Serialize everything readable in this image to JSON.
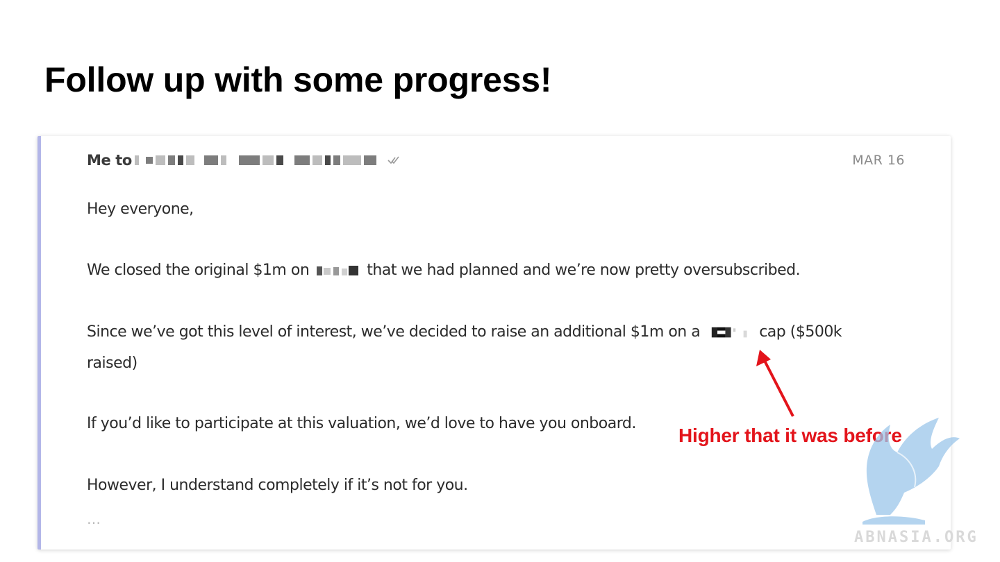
{
  "slide": {
    "title": "Follow up with some progress!"
  },
  "email": {
    "sender": "Me to",
    "date": "MAR 16",
    "greeting": "Hey everyone,",
    "para1_a": "We closed the original $1m on",
    "para1_b": "that we had planned and we’re now pretty oversubscribed.",
    "para2_a": "Since we’ve got this level of interest, we’ve decided to raise an additional $1m on a",
    "para2_b": "cap ($500k",
    "para2_c": "raised)",
    "para3": "If you’d like to participate at this valuation, we’d love to have you onboard.",
    "para4": "However, I understand completely if it’s not for you.",
    "ellipsis": "…",
    "accent_color": "#b3b6e8"
  },
  "annotation": {
    "text": "Higher that it was before",
    "color": "#e3141b"
  },
  "watermark": {
    "text": "ABNASIA.ORG",
    "logo_icon": "griffin-logo-icon"
  },
  "icons": {
    "read_receipt": "double-check-icon"
  }
}
